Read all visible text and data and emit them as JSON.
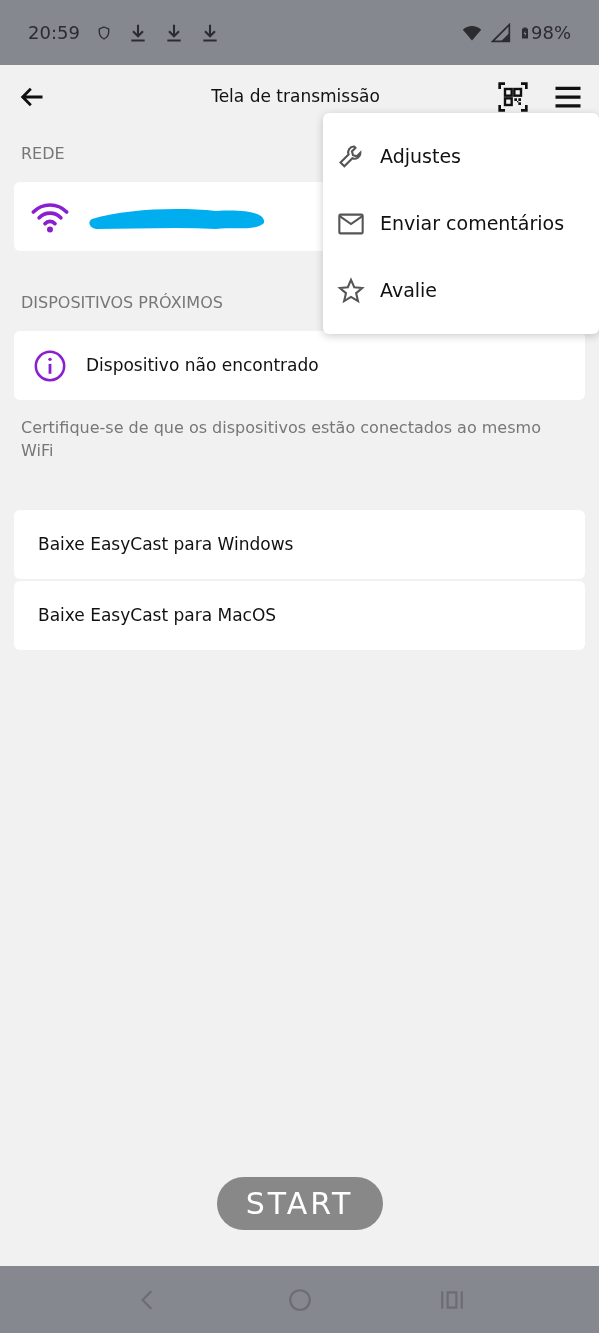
{
  "status_bar": {
    "time": "20:59",
    "battery": "98%"
  },
  "app_bar": {
    "title": "Tela de transmissão"
  },
  "network": {
    "heading": "REDE",
    "name_redacted": true
  },
  "nearby": {
    "heading": "DISPOSITIVOS PRÓXIMOS",
    "message": "Dispositivo não encontrado",
    "hint": "Certifique-se de que os dispositivos estão conectados ao mesmo WiFi"
  },
  "downloads": [
    {
      "label": "Baixe EasyCast para Windows"
    },
    {
      "label": "Baixe EasyCast para MacOS"
    }
  ],
  "start_button": {
    "label": "START"
  },
  "menu": {
    "items": [
      {
        "kind": "settings",
        "label": "Adjustes"
      },
      {
        "kind": "feedback",
        "label": "Enviar comentários"
      },
      {
        "kind": "rate",
        "label": "Avalie"
      }
    ]
  }
}
